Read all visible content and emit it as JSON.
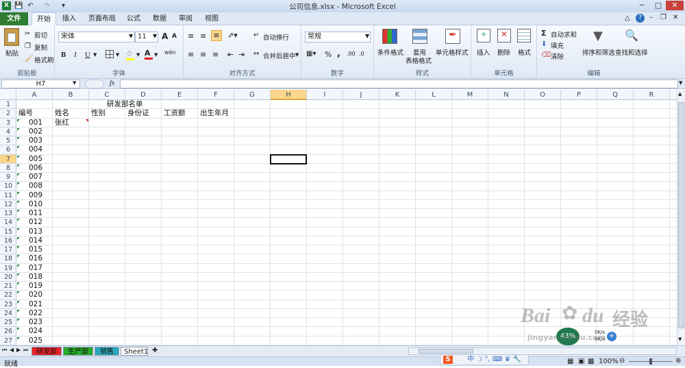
{
  "window": {
    "title": "公司信息.xlsx - Microsoft Excel",
    "minimize": "─",
    "maximize": "□",
    "close": "✕"
  },
  "menu": {
    "file": "文件",
    "tabs": [
      "开始",
      "插入",
      "页面布局",
      "公式",
      "数据",
      "审阅",
      "视图"
    ]
  },
  "ribbon": {
    "clipboard": {
      "label": "剪贴板",
      "paste": "粘贴",
      "cut": "剪切",
      "copy": "复制",
      "format_painter": "格式刷"
    },
    "font": {
      "label": "字体",
      "name": "宋体",
      "size": "11",
      "bold": "B",
      "italic": "I",
      "underline": "U",
      "grow": "A",
      "shrink": "A",
      "phonetic": "wén"
    },
    "alignment": {
      "label": "对齐方式",
      "wrap": "自动换行",
      "merge": "合并后居中"
    },
    "number": {
      "label": "数字",
      "format": "常规",
      "percent": "%",
      "comma": ","
    },
    "styles": {
      "label": "样式",
      "conditional": "条件格式",
      "table": "套用",
      "table2": "表格格式",
      "cell_styles": "单元格样式"
    },
    "cells": {
      "label": "单元格",
      "insert": "插入",
      "delete": "删除",
      "format": "格式"
    },
    "editing": {
      "label": "编辑",
      "autosum": "自动求和",
      "fill": "填充",
      "clear": "清除",
      "sort": "排序和筛选",
      "find": "查找和选择"
    }
  },
  "formula_bar": {
    "name_box": "H7",
    "fx": "fx",
    "value": ""
  },
  "columns": [
    "A",
    "B",
    "C",
    "D",
    "E",
    "F",
    "G",
    "H",
    "I",
    "J",
    "K",
    "L",
    "M",
    "N",
    "O",
    "P",
    "Q",
    "R"
  ],
  "selected_column": "H",
  "rows": [
    "1",
    "2",
    "3",
    "4",
    "5",
    "6",
    "7",
    "8",
    "9",
    "10",
    "11",
    "12",
    "13",
    "14",
    "15",
    "16",
    "17",
    "18",
    "19",
    "20",
    "21",
    "22",
    "23",
    "24",
    "25",
    "26",
    "27"
  ],
  "selected_row": "7",
  "cells": {
    "C1": "研发部名单",
    "A2": "编号",
    "B2": "姓名",
    "C2": "性别",
    "D2": "身份证",
    "E2": "工资额",
    "F2": "出生年月",
    "B3": "张红",
    "ids": [
      "001",
      "002",
      "003",
      "004",
      "005",
      "006",
      "007",
      "008",
      "009",
      "010",
      "011",
      "012",
      "013",
      "014",
      "015",
      "016",
      "017",
      "018",
      "019",
      "020",
      "021",
      "022",
      "023",
      "024",
      "025"
    ]
  },
  "sheets": [
    {
      "name": "研发部",
      "color": "#e8232a"
    },
    {
      "name": "生产部",
      "color": "#29a829"
    },
    {
      "name": "销售部",
      "color": "#29a8b8"
    },
    {
      "name": "Sheet1",
      "color": "#ffffff"
    }
  ],
  "status": {
    "mode": "就绪",
    "zoom": "100%",
    "speed_percent": "43%",
    "ok1": "0K/s",
    "ok2": "0K/s"
  },
  "watermark": {
    "brand": "Bai",
    "du": "du",
    "jingyan": "经验",
    "url": "jingyan.baidu.com"
  }
}
